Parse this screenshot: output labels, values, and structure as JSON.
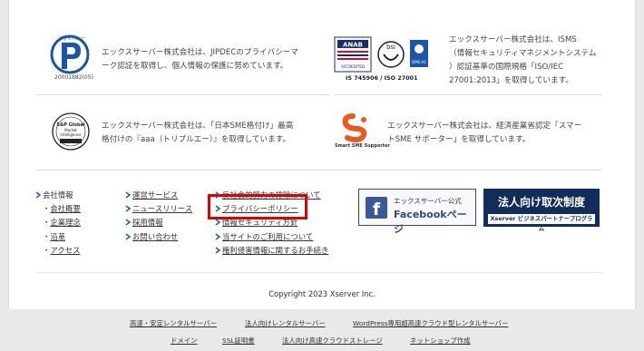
{
  "certifications": [
    {
      "logo_caption": "20001882(05)",
      "text_lines": [
        "エックスサーバー株式会社は、JIPDECのプライバシーマ",
        "ーク認証を取得し、個人情報の保護に努めています。"
      ]
    },
    {
      "logo_caption": "IS 745906 / ISO 27001",
      "text_lines": [
        "エックスサーバー株式会社は、ISMS",
        "（情報セキュリティマネジメントシステム",
        "）認証基準の国際規格「ISO/IEC",
        "27001:2013」を取得しています。"
      ]
    },
    {
      "logo_caption": "",
      "text_lines": [
        "エックスサーバー株式会社は、「日本SME格付け」最高",
        "格付けの『aaa（トリプルエー）』を取得しています。"
      ]
    },
    {
      "logo_caption": "Smart SME Supporter",
      "text_lines": [
        "エックスサーバー株式会社は、経済産業省認定「スマー",
        "トSME サポーター」を取得しています。"
      ]
    }
  ],
  "footer_nav": {
    "col1": {
      "title": "会社情報",
      "items": [
        "会社概要",
        "企業理念",
        "沿革",
        "アクセス"
      ]
    },
    "col2": {
      "items": [
        "運営サービス",
        "ニュースリリース",
        "採用情報",
        "お問い合わせ"
      ]
    },
    "col3": {
      "items": [
        "反社会的勢力の排除について",
        "プライバシーポリシー",
        "情報セキュリティ方針",
        "当サイトのご利用について",
        "権利侵害情報に関するお手続き"
      ]
    }
  },
  "banners": {
    "facebook": {
      "line1": "エックスサーバー公式",
      "line2": "Facebookページ"
    },
    "business": {
      "title": "法人向け取次制度",
      "subtitle": "Xserver ビジネスパートナープログラム"
    }
  },
  "copyright": "Copyright 2023 Xserver Inc.",
  "bottom_links": {
    "row1": [
      "高速・安定レンタルサーバー",
      "法人向けレンタルサーバー",
      "WordPress専用超高速クラウド型レンタルサーバー"
    ],
    "row2": [
      "ドメイン",
      "SSL証明書",
      "法人向け高速クラウドストレージ",
      "ネットショップ作成"
    ]
  },
  "colors": {
    "accent_arrow": "#1b5fa8",
    "highlight": "#e10000"
  }
}
